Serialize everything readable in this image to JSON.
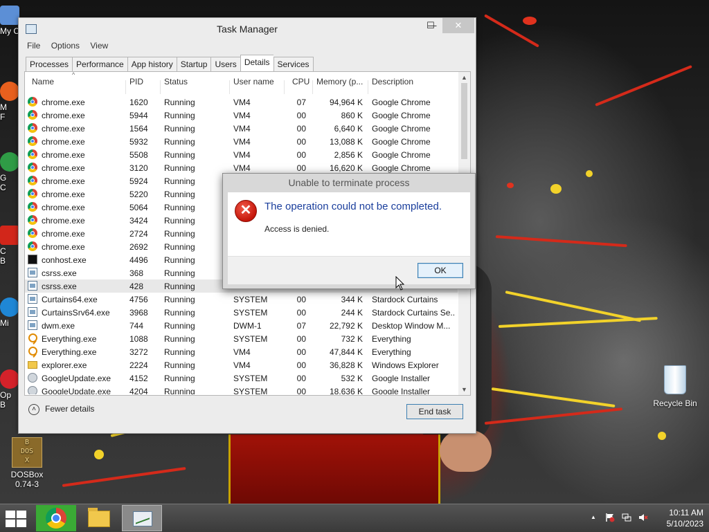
{
  "desktop": {
    "icons": {
      "dosbox": {
        "line1": "DOSBox",
        "line2": "0.74-3"
      },
      "recycle_bin": "Recycle Bin",
      "edge_labels": [
        "My C",
        "M",
        "F",
        "G",
        "C",
        "C",
        "B",
        "Mi",
        "Op",
        "B"
      ]
    }
  },
  "task_manager": {
    "title": "Task Manager",
    "window_controls": {
      "minimize": "—",
      "maximize": "☐",
      "close": "✕"
    },
    "menu": [
      "File",
      "Options",
      "View"
    ],
    "tabs": [
      "Processes",
      "Performance",
      "App history",
      "Startup",
      "Users",
      "Details",
      "Services"
    ],
    "active_tab": "Details",
    "columns": [
      "Name",
      "PID",
      "Status",
      "User name",
      "CPU",
      "Memory (p...",
      "Description"
    ],
    "sort_indicator": "^",
    "rows": [
      {
        "icon": "chrome-icon",
        "name": "chrome.exe",
        "pid": "1620",
        "status": "Running",
        "user": "VM4",
        "cpu": "07",
        "mem": "94,964 K",
        "desc": "Google Chrome"
      },
      {
        "icon": "chrome-icon",
        "name": "chrome.exe",
        "pid": "5944",
        "status": "Running",
        "user": "VM4",
        "cpu": "00",
        "mem": "860 K",
        "desc": "Google Chrome"
      },
      {
        "icon": "chrome-icon",
        "name": "chrome.exe",
        "pid": "1564",
        "status": "Running",
        "user": "VM4",
        "cpu": "00",
        "mem": "6,640 K",
        "desc": "Google Chrome"
      },
      {
        "icon": "chrome-icon",
        "name": "chrome.exe",
        "pid": "5932",
        "status": "Running",
        "user": "VM4",
        "cpu": "00",
        "mem": "13,088 K",
        "desc": "Google Chrome"
      },
      {
        "icon": "chrome-icon",
        "name": "chrome.exe",
        "pid": "5508",
        "status": "Running",
        "user": "VM4",
        "cpu": "00",
        "mem": "2,856 K",
        "desc": "Google Chrome"
      },
      {
        "icon": "chrome-icon",
        "name": "chrome.exe",
        "pid": "3120",
        "status": "Running",
        "user": "VM4",
        "cpu": "00",
        "mem": "16,620 K",
        "desc": "Google Chrome"
      },
      {
        "icon": "chrome-icon",
        "name": "chrome.exe",
        "pid": "5924",
        "status": "Running",
        "user": "",
        "cpu": "",
        "mem": "",
        "desc": ""
      },
      {
        "icon": "chrome-icon",
        "name": "chrome.exe",
        "pid": "5220",
        "status": "Running",
        "user": "",
        "cpu": "",
        "mem": "",
        "desc": ""
      },
      {
        "icon": "chrome-icon",
        "name": "chrome.exe",
        "pid": "5064",
        "status": "Running",
        "user": "",
        "cpu": "",
        "mem": "",
        "desc": ""
      },
      {
        "icon": "chrome-icon",
        "name": "chrome.exe",
        "pid": "3424",
        "status": "Running",
        "user": "",
        "cpu": "",
        "mem": "",
        "desc": ""
      },
      {
        "icon": "chrome-icon",
        "name": "chrome.exe",
        "pid": "2724",
        "status": "Running",
        "user": "",
        "cpu": "",
        "mem": "",
        "desc": ""
      },
      {
        "icon": "chrome-icon",
        "name": "chrome.exe",
        "pid": "2692",
        "status": "Running",
        "user": "",
        "cpu": "",
        "mem": "",
        "desc": ""
      },
      {
        "icon": "console-icon",
        "name": "conhost.exe",
        "pid": "4496",
        "status": "Running",
        "user": "",
        "cpu": "",
        "mem": "",
        "desc": ""
      },
      {
        "icon": "app-icon",
        "name": "csrss.exe",
        "pid": "368",
        "status": "Running",
        "user": "",
        "cpu": "",
        "mem": "",
        "desc": ""
      },
      {
        "icon": "app-icon",
        "name": "csrss.exe",
        "pid": "428",
        "status": "Running",
        "user": "",
        "cpu": "",
        "mem": "",
        "desc": "",
        "selected": true
      },
      {
        "icon": "app-icon",
        "name": "Curtains64.exe",
        "pid": "4756",
        "status": "Running",
        "user": "SYSTEM",
        "cpu": "00",
        "mem": "344 K",
        "desc": "Stardock Curtains"
      },
      {
        "icon": "app-icon",
        "name": "CurtainsSrv64.exe",
        "pid": "3968",
        "status": "Running",
        "user": "SYSTEM",
        "cpu": "00",
        "mem": "244 K",
        "desc": "Stardock Curtains Se..."
      },
      {
        "icon": "app-icon",
        "name": "dwm.exe",
        "pid": "744",
        "status": "Running",
        "user": "DWM-1",
        "cpu": "07",
        "mem": "22,792 K",
        "desc": "Desktop Window M..."
      },
      {
        "icon": "search-icon",
        "name": "Everything.exe",
        "pid": "1088",
        "status": "Running",
        "user": "SYSTEM",
        "cpu": "00",
        "mem": "732 K",
        "desc": "Everything"
      },
      {
        "icon": "search-icon",
        "name": "Everything.exe",
        "pid": "3272",
        "status": "Running",
        "user": "VM4",
        "cpu": "00",
        "mem": "47,844 K",
        "desc": "Everything"
      },
      {
        "icon": "folder-icon",
        "name": "explorer.exe",
        "pid": "2224",
        "status": "Running",
        "user": "VM4",
        "cpu": "00",
        "mem": "36,828 K",
        "desc": "Windows Explorer"
      },
      {
        "icon": "update-icon",
        "name": "GoogleUpdate.exe",
        "pid": "4152",
        "status": "Running",
        "user": "SYSTEM",
        "cpu": "00",
        "mem": "532 K",
        "desc": "Google Installer"
      },
      {
        "icon": "update-icon",
        "name": "GoogleUpdate.exe",
        "pid": "4204",
        "status": "Running",
        "user": "SYSTEM",
        "cpu": "00",
        "mem": "18,636 K",
        "desc": "Google Installer"
      }
    ],
    "fewer_details": "Fewer details",
    "end_task": "End task"
  },
  "dialog": {
    "title": "Unable to terminate process",
    "main_text": "The operation could not be completed.",
    "sub_text": "Access is denied.",
    "ok": "OK",
    "icon": "error-icon"
  },
  "taskbar": {
    "apps": [
      "chrome-icon",
      "file-explorer-icon",
      "task-manager-icon"
    ],
    "clock": {
      "time": "10:11 AM",
      "date": "5/10/2023"
    },
    "tray_chevron": "▲"
  }
}
